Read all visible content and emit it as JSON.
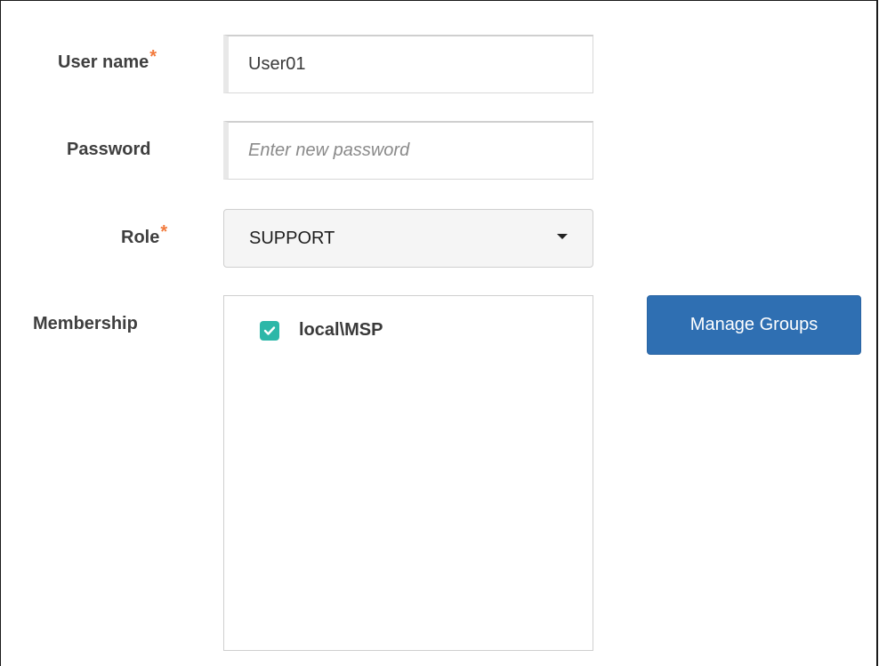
{
  "form": {
    "username": {
      "label": "User name",
      "required_mark": "*",
      "value": "User01"
    },
    "password": {
      "label": "Password",
      "value": "",
      "placeholder": "Enter new password"
    },
    "role": {
      "label": "Role",
      "required_mark": "*",
      "selected": "SUPPORT"
    },
    "membership": {
      "label": "Membership",
      "items": [
        {
          "label": "local\\MSP",
          "checked": true
        }
      ],
      "manage_button_label": "Manage Groups"
    }
  },
  "colors": {
    "required_mark": "#f27a3c",
    "checkbox": "#2cb7a8",
    "primary_button": "#2f6fb2"
  },
  "icons": {
    "role_dropdown": "caret-down-icon",
    "member_checkbox": "check-icon"
  }
}
